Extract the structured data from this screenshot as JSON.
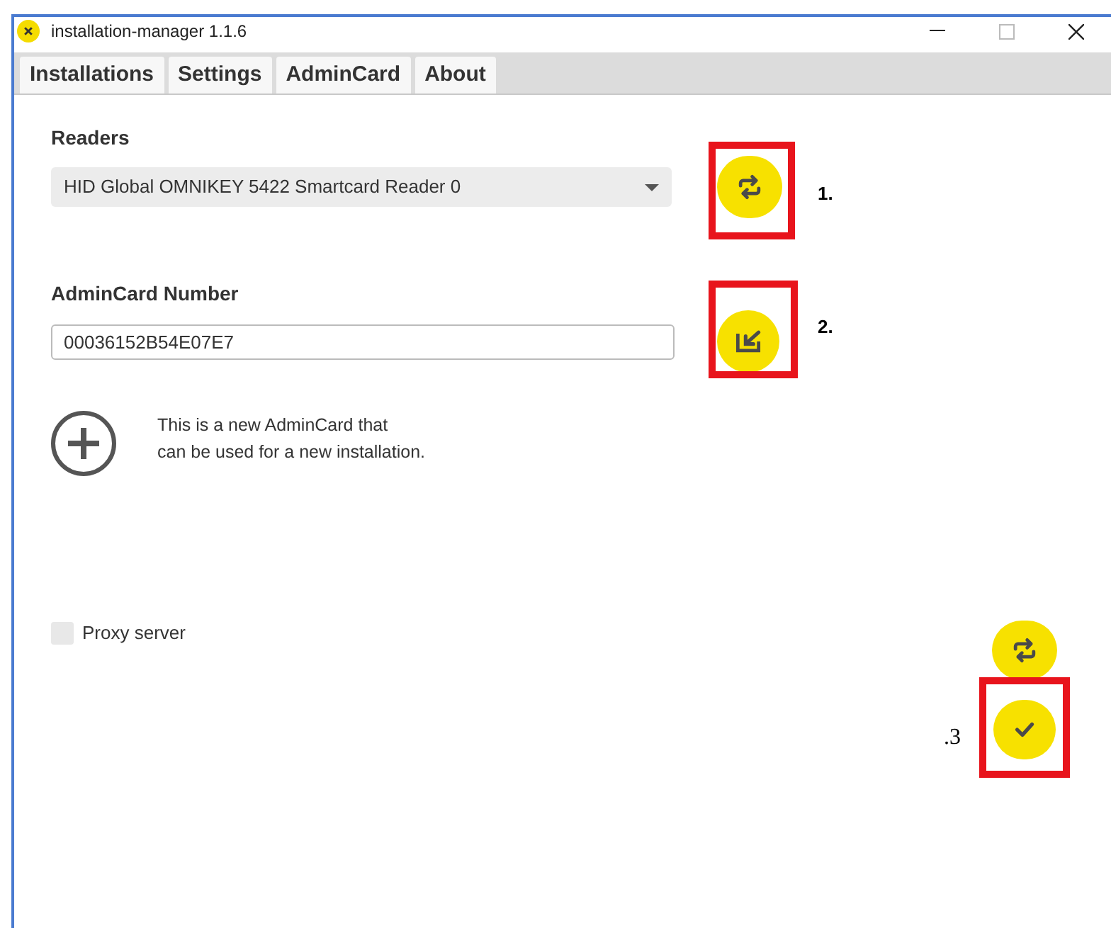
{
  "window": {
    "title": "installation-manager 1.1.6"
  },
  "tabs": [
    {
      "label": "Installations"
    },
    {
      "label": "Settings"
    },
    {
      "label": "AdminCard"
    },
    {
      "label": "About"
    }
  ],
  "readers": {
    "label": "Readers",
    "value": "HID Global OMNIKEY 5422 Smartcard Reader 0"
  },
  "admin_card": {
    "label": "AdminCard Number",
    "value": "00036152B54E07E7"
  },
  "new_card_note": [
    "This is a new AdminCard that",
    "can be used for a new installation."
  ],
  "proxy": {
    "label": "Proxy server",
    "checked": false
  },
  "annotations": [
    {
      "label": "1."
    },
    {
      "label": "2."
    },
    {
      "label": ".3"
    }
  ]
}
